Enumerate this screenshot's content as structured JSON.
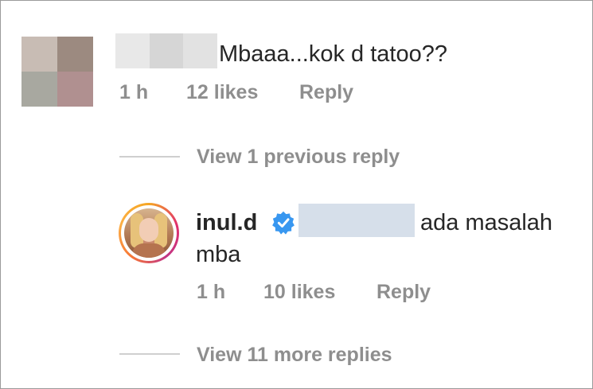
{
  "comment": {
    "text": "Mbaaa...kok d tatoo??",
    "time": "1 h",
    "likes": "12 likes",
    "reply_label": "Reply",
    "avatar_blur_colors": [
      "#c8bcb4",
      "#9c8a80",
      "#a8a8a0",
      "#b09090"
    ],
    "username_blur_colors": [
      "#e8e8e8",
      "#d6d6d6",
      "#e2e2e2"
    ]
  },
  "view_previous": "View 1 previous reply",
  "reply": {
    "username": "inul.d",
    "verified_icon": "verified-badge-icon",
    "verified_color": "#3897f0",
    "mention_blur_color": "#d6dfea",
    "text_line1": "ada masalah",
    "text_line2": "mba",
    "time": "1 h",
    "likes": "10 likes",
    "reply_label": "Reply"
  },
  "view_more": "View 11 more replies"
}
